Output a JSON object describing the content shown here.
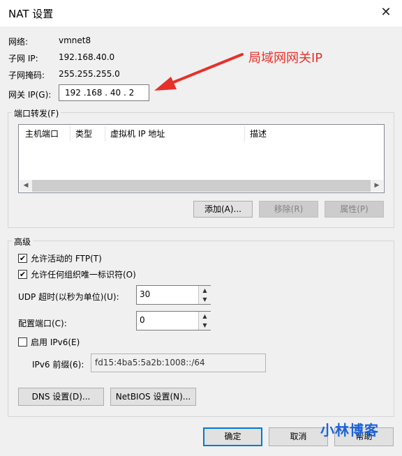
{
  "window": {
    "title": "NAT 设置",
    "close_icon": "close-icon"
  },
  "info": {
    "network_label": "网络:",
    "network_value": "vmnet8",
    "subnet_ip_label": "子网 IP:",
    "subnet_ip_value": "192.168.40.0",
    "subnet_mask_label": "子网掩码:",
    "subnet_mask_value": "255.255.255.0",
    "gateway_label": "网关 IP(G):",
    "gateway_value": "192 .168 . 40  . 2"
  },
  "annotation": {
    "text": "局域网网关IP",
    "color": "#e8302a"
  },
  "port_forwarding": {
    "title": "端口转发(F)",
    "columns": [
      "主机端口",
      "类型",
      "虚拟机 IP 地址",
      "描述"
    ],
    "rows": [],
    "add_button": "添加(A)...",
    "remove_button": "移除(R)",
    "properties_button": "属性(P)"
  },
  "advanced": {
    "title": "高级",
    "allow_ftp": {
      "label": "允许活动的 FTP(T)",
      "checked": true
    },
    "allow_oui": {
      "label": "允许任何组织唯一标识符(O)",
      "checked": true
    },
    "udp_timeout_label": "UDP 超时(以秒为单位)(U):",
    "udp_timeout_value": "30",
    "config_port_label": "配置端口(C):",
    "config_port_value": "0",
    "enable_ipv6": {
      "label": "启用 IPv6(E)",
      "checked": false
    },
    "ipv6_prefix_label": "IPv6 前缀(6):",
    "ipv6_prefix_value": "fd15:4ba5:5a2b:1008::/64",
    "dns_button": "DNS 设置(D)...",
    "netbios_button": "NetBIOS 设置(N)..."
  },
  "footer": {
    "ok": "确定",
    "cancel": "取消",
    "help": "帮助"
  },
  "watermark": {
    "text": "小林博客",
    "color": "#1c63d8"
  },
  "colors": {
    "accent": "#0078d7"
  }
}
